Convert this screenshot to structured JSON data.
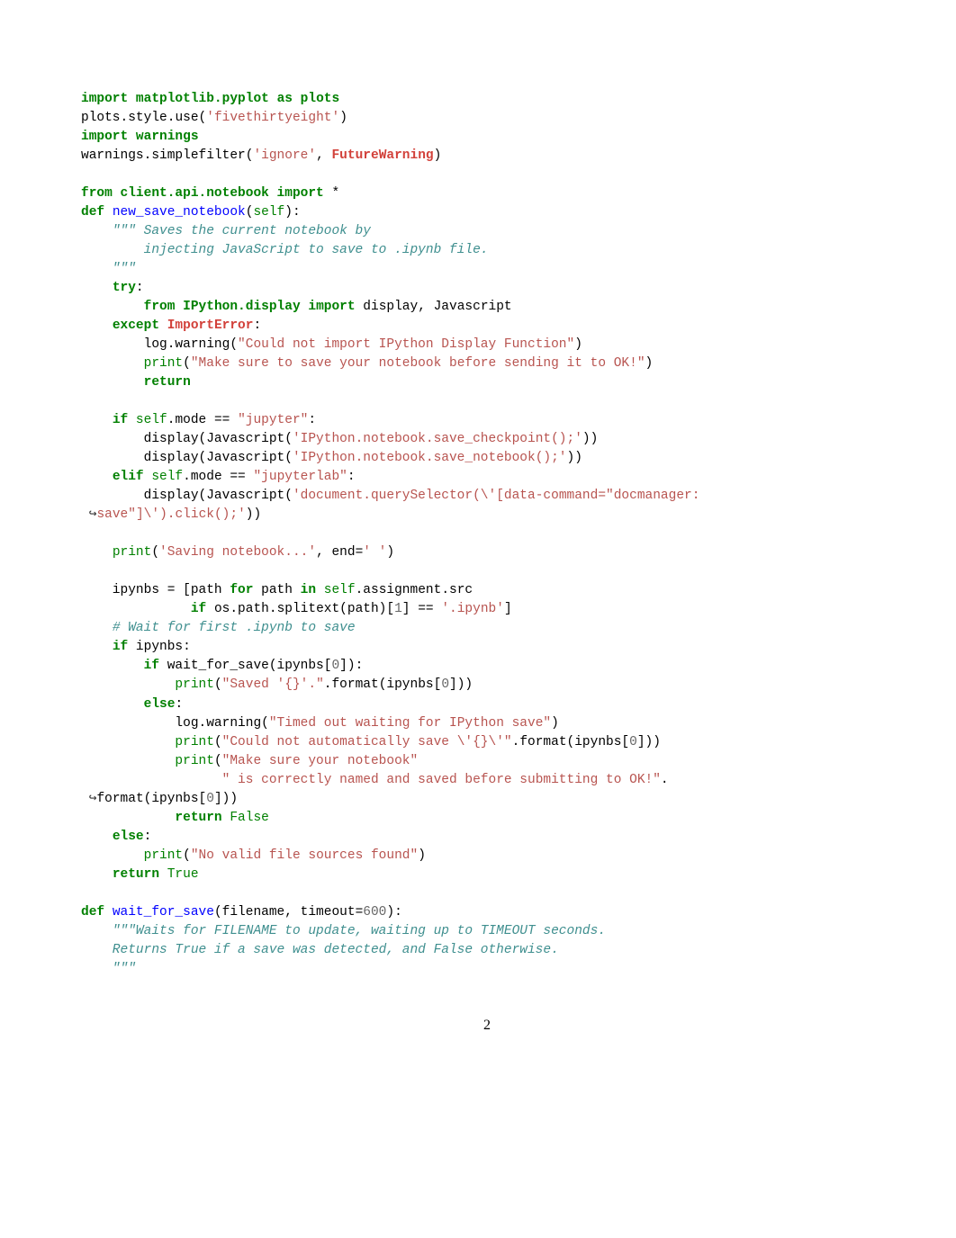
{
  "lines": [
    {
      "type": "code",
      "segments": [
        {
          "t": "import ",
          "c": "kw"
        },
        {
          "t": "matplotlib.pyplot ",
          "c": "nn"
        },
        {
          "t": "as ",
          "c": "kw"
        },
        {
          "t": "plots",
          "c": "nn"
        }
      ]
    },
    {
      "type": "code",
      "segments": [
        {
          "t": "plots"
        },
        {
          "t": "."
        },
        {
          "t": "style"
        },
        {
          "t": "."
        },
        {
          "t": "use("
        },
        {
          "t": "'fivethirtyeight'",
          "c": "str"
        },
        {
          "t": ")"
        }
      ]
    },
    {
      "type": "code",
      "segments": [
        {
          "t": "import ",
          "c": "kw"
        },
        {
          "t": "warnings",
          "c": "nn"
        }
      ]
    },
    {
      "type": "code",
      "segments": [
        {
          "t": "warnings"
        },
        {
          "t": "."
        },
        {
          "t": "simplefilter("
        },
        {
          "t": "'ignore'",
          "c": "str"
        },
        {
          "t": ", "
        },
        {
          "t": "FutureWarning",
          "c": "err"
        },
        {
          "t": ")"
        }
      ]
    },
    {
      "type": "blank"
    },
    {
      "type": "code",
      "segments": [
        {
          "t": "from ",
          "c": "kw"
        },
        {
          "t": "client.api.notebook ",
          "c": "nn"
        },
        {
          "t": "import ",
          "c": "kw"
        },
        {
          "t": "*"
        }
      ]
    },
    {
      "type": "code",
      "segments": [
        {
          "t": "def ",
          "c": "kw"
        },
        {
          "t": "new_save_notebook",
          "c": "fn"
        },
        {
          "t": "("
        },
        {
          "t": "self",
          "c": "self"
        },
        {
          "t": "):"
        }
      ]
    },
    {
      "type": "code",
      "segments": [
        {
          "t": "    "
        },
        {
          "t": "\"\"\" Saves the current notebook by",
          "c": "com"
        }
      ]
    },
    {
      "type": "code",
      "segments": [
        {
          "t": "        injecting JavaScript to save to .ipynb file.",
          "c": "com"
        }
      ]
    },
    {
      "type": "code",
      "segments": [
        {
          "t": "    \"\"\"",
          "c": "com"
        }
      ]
    },
    {
      "type": "code",
      "segments": [
        {
          "t": "    "
        },
        {
          "t": "try",
          "c": "kw"
        },
        {
          "t": ":"
        }
      ]
    },
    {
      "type": "code",
      "segments": [
        {
          "t": "        "
        },
        {
          "t": "from ",
          "c": "kw"
        },
        {
          "t": "IPython.display ",
          "c": "nn"
        },
        {
          "t": "import ",
          "c": "kw"
        },
        {
          "t": "display, Javascript"
        }
      ]
    },
    {
      "type": "code",
      "segments": [
        {
          "t": "    "
        },
        {
          "t": "except ",
          "c": "kw"
        },
        {
          "t": "ImportError",
          "c": "err"
        },
        {
          "t": ":"
        }
      ]
    },
    {
      "type": "code",
      "segments": [
        {
          "t": "        log"
        },
        {
          "t": "."
        },
        {
          "t": "warning("
        },
        {
          "t": "\"Could not import IPython Display Function\"",
          "c": "str"
        },
        {
          "t": ")"
        }
      ]
    },
    {
      "type": "code",
      "segments": [
        {
          "t": "        "
        },
        {
          "t": "print",
          "c": "cls"
        },
        {
          "t": "("
        },
        {
          "t": "\"Make sure to save your notebook before sending it to OK!\"",
          "c": "str"
        },
        {
          "t": ")"
        }
      ]
    },
    {
      "type": "code",
      "segments": [
        {
          "t": "        "
        },
        {
          "t": "return",
          "c": "kw"
        }
      ]
    },
    {
      "type": "blank"
    },
    {
      "type": "code",
      "segments": [
        {
          "t": "    "
        },
        {
          "t": "if ",
          "c": "kw"
        },
        {
          "t": "self",
          "c": "self"
        },
        {
          "t": "."
        },
        {
          "t": "mode "
        },
        {
          "t": "=="
        },
        {
          "t": " "
        },
        {
          "t": "\"jupyter\"",
          "c": "str"
        },
        {
          "t": ":"
        }
      ]
    },
    {
      "type": "code",
      "segments": [
        {
          "t": "        display(Javascript("
        },
        {
          "t": "'IPython.notebook.save_checkpoint();'",
          "c": "str"
        },
        {
          "t": "))"
        }
      ]
    },
    {
      "type": "code",
      "segments": [
        {
          "t": "        display(Javascript("
        },
        {
          "t": "'IPython.notebook.save_notebook();'",
          "c": "str"
        },
        {
          "t": "))"
        }
      ]
    },
    {
      "type": "code",
      "segments": [
        {
          "t": "    "
        },
        {
          "t": "elif ",
          "c": "kw"
        },
        {
          "t": "self",
          "c": "self"
        },
        {
          "t": "."
        },
        {
          "t": "mode "
        },
        {
          "t": "=="
        },
        {
          "t": " "
        },
        {
          "t": "\"jupyterlab\"",
          "c": "str"
        },
        {
          "t": ":"
        }
      ]
    },
    {
      "type": "code",
      "segments": [
        {
          "t": "        display(Javascript("
        },
        {
          "t": "'document.querySelector(",
          "c": "str"
        },
        {
          "t": "\\'",
          "c": "str"
        },
        {
          "t": "[data-command=\"docmanager:",
          "c": "str"
        }
      ]
    },
    {
      "type": "code",
      "segments": [
        {
          "t": " ↪",
          "c": "arrow"
        },
        {
          "t": "save\"]",
          "c": "str"
        },
        {
          "t": "\\'",
          "c": "str"
        },
        {
          "t": ").click();'",
          "c": "str"
        },
        {
          "t": "))"
        }
      ]
    },
    {
      "type": "blank"
    },
    {
      "type": "code",
      "segments": [
        {
          "t": "    "
        },
        {
          "t": "print",
          "c": "cls"
        },
        {
          "t": "("
        },
        {
          "t": "'Saving notebook...'",
          "c": "str"
        },
        {
          "t": ", end"
        },
        {
          "t": "="
        },
        {
          "t": "' '",
          "c": "str"
        },
        {
          "t": ")"
        }
      ]
    },
    {
      "type": "blank"
    },
    {
      "type": "code",
      "segments": [
        {
          "t": "    ipynbs "
        },
        {
          "t": "="
        },
        {
          "t": " [path "
        },
        {
          "t": "for ",
          "c": "kw"
        },
        {
          "t": "path "
        },
        {
          "t": "in ",
          "c": "kw"
        },
        {
          "t": "self",
          "c": "self"
        },
        {
          "t": "."
        },
        {
          "t": "assignment"
        },
        {
          "t": "."
        },
        {
          "t": "src"
        }
      ]
    },
    {
      "type": "code",
      "segments": [
        {
          "t": "              "
        },
        {
          "t": "if ",
          "c": "kw"
        },
        {
          "t": "os"
        },
        {
          "t": "."
        },
        {
          "t": "path"
        },
        {
          "t": "."
        },
        {
          "t": "splitext(path)["
        },
        {
          "t": "1",
          "c": "num"
        },
        {
          "t": "] "
        },
        {
          "t": "=="
        },
        {
          "t": " "
        },
        {
          "t": "'.ipynb'",
          "c": "str"
        },
        {
          "t": "]"
        }
      ]
    },
    {
      "type": "code",
      "segments": [
        {
          "t": "    "
        },
        {
          "t": "# Wait for first .ipynb to save",
          "c": "com"
        }
      ]
    },
    {
      "type": "code",
      "segments": [
        {
          "t": "    "
        },
        {
          "t": "if ",
          "c": "kw"
        },
        {
          "t": "ipynbs:"
        }
      ]
    },
    {
      "type": "code",
      "segments": [
        {
          "t": "        "
        },
        {
          "t": "if ",
          "c": "kw"
        },
        {
          "t": "wait_for_save(ipynbs["
        },
        {
          "t": "0",
          "c": "num"
        },
        {
          "t": "]):"
        }
      ]
    },
    {
      "type": "code",
      "segments": [
        {
          "t": "            "
        },
        {
          "t": "print",
          "c": "cls"
        },
        {
          "t": "("
        },
        {
          "t": "\"Saved '",
          "c": "str"
        },
        {
          "t": "{}",
          "c": "str"
        },
        {
          "t": "'.\"",
          "c": "str"
        },
        {
          "t": "."
        },
        {
          "t": "format(ipynbs["
        },
        {
          "t": "0",
          "c": "num"
        },
        {
          "t": "]))"
        }
      ]
    },
    {
      "type": "code",
      "segments": [
        {
          "t": "        "
        },
        {
          "t": "else",
          "c": "kw"
        },
        {
          "t": ":"
        }
      ]
    },
    {
      "type": "code",
      "segments": [
        {
          "t": "            log"
        },
        {
          "t": "."
        },
        {
          "t": "warning("
        },
        {
          "t": "\"Timed out waiting for IPython save\"",
          "c": "str"
        },
        {
          "t": ")"
        }
      ]
    },
    {
      "type": "code",
      "segments": [
        {
          "t": "            "
        },
        {
          "t": "print",
          "c": "cls"
        },
        {
          "t": "("
        },
        {
          "t": "\"Could not automatically save ",
          "c": "str"
        },
        {
          "t": "\\'",
          "c": "str"
        },
        {
          "t": "{}",
          "c": "str"
        },
        {
          "t": "\\'",
          "c": "str"
        },
        {
          "t": "\"",
          "c": "str"
        },
        {
          "t": "."
        },
        {
          "t": "format(ipynbs["
        },
        {
          "t": "0",
          "c": "num"
        },
        {
          "t": "]))"
        }
      ]
    },
    {
      "type": "code",
      "segments": [
        {
          "t": "            "
        },
        {
          "t": "print",
          "c": "cls"
        },
        {
          "t": "("
        },
        {
          "t": "\"Make sure your notebook\"",
          "c": "str"
        }
      ]
    },
    {
      "type": "code",
      "segments": [
        {
          "t": "                  "
        },
        {
          "t": "\" is correctly named and saved before submitting to OK!\"",
          "c": "str"
        },
        {
          "t": "."
        }
      ]
    },
    {
      "type": "code",
      "segments": [
        {
          "t": " ↪",
          "c": "arrow"
        },
        {
          "t": "format(ipynbs["
        },
        {
          "t": "0",
          "c": "num"
        },
        {
          "t": "]))"
        }
      ]
    },
    {
      "type": "code",
      "segments": [
        {
          "t": "            "
        },
        {
          "t": "return ",
          "c": "kw"
        },
        {
          "t": "False",
          "c": "const"
        }
      ]
    },
    {
      "type": "code",
      "segments": [
        {
          "t": "    "
        },
        {
          "t": "else",
          "c": "kw"
        },
        {
          "t": ":"
        }
      ]
    },
    {
      "type": "code",
      "segments": [
        {
          "t": "        "
        },
        {
          "t": "print",
          "c": "cls"
        },
        {
          "t": "("
        },
        {
          "t": "\"No valid file sources found\"",
          "c": "str"
        },
        {
          "t": ")"
        }
      ]
    },
    {
      "type": "code",
      "segments": [
        {
          "t": "    "
        },
        {
          "t": "return ",
          "c": "kw"
        },
        {
          "t": "True",
          "c": "const"
        }
      ]
    },
    {
      "type": "blank"
    },
    {
      "type": "code",
      "segments": [
        {
          "t": "def ",
          "c": "kw"
        },
        {
          "t": "wait_for_save",
          "c": "fn"
        },
        {
          "t": "(filename, timeout"
        },
        {
          "t": "="
        },
        {
          "t": "600",
          "c": "num"
        },
        {
          "t": "):"
        }
      ]
    },
    {
      "type": "code",
      "segments": [
        {
          "t": "    "
        },
        {
          "t": "\"\"\"Waits for FILENAME to update, waiting up to TIMEOUT seconds.",
          "c": "com"
        }
      ]
    },
    {
      "type": "code",
      "segments": [
        {
          "t": "    Returns True if a save was detected, and False otherwise.",
          "c": "com"
        }
      ]
    },
    {
      "type": "code",
      "segments": [
        {
          "t": "    \"\"\"",
          "c": "com"
        }
      ]
    }
  ],
  "page_number": "2"
}
